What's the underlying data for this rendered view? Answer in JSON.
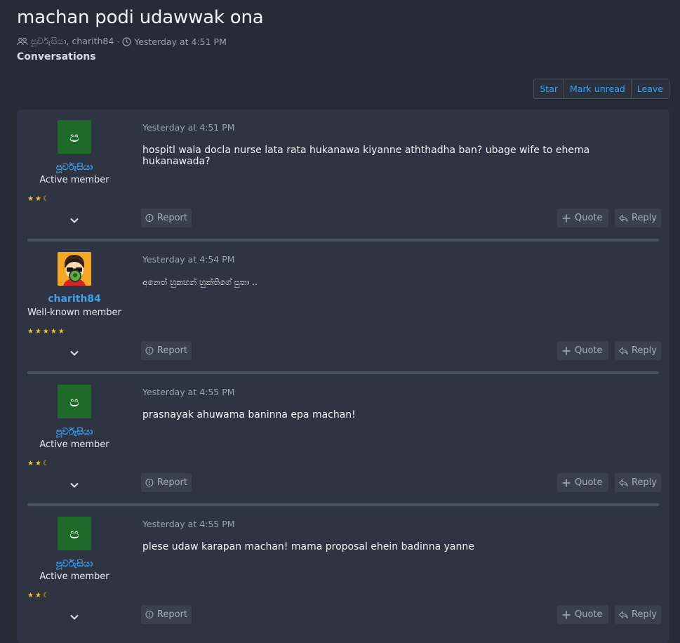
{
  "thread": {
    "title": "machan podi udawwak ona",
    "participants": "පූර්වැසියා, charith84",
    "separator": "·",
    "date": "Yesterday at 4:51 PM",
    "breadcrumb": "Conversations"
  },
  "toolbar": {
    "star": "Star",
    "mark_unread": "Mark unread",
    "leave": "Leave"
  },
  "messages": [
    {
      "avatar_letter": "ප",
      "username": "පූර්වැසියා",
      "user_title": "Active member",
      "stars": "★★",
      "date": "Yesterday at 4:51 PM",
      "body": "hospitl wala docla nurse lata rata hukanawa kiyanne aththadha ban? ubage wife to ehema hukanawada?",
      "report": "Report",
      "quote": "Quote",
      "reply": "Reply"
    },
    {
      "avatar_letter": "",
      "username": "charith84",
      "user_title": "Well-known member",
      "stars": "★★★★★",
      "date": "Yesterday at 4:54 PM",
      "body": "අනෙත් හුකහන් හුක්තිගේ පුතා ..",
      "report": "Report",
      "quote": "Quote",
      "reply": "Reply"
    },
    {
      "avatar_letter": "ප",
      "username": "පූර්වැසියා",
      "user_title": "Active member",
      "stars": "★★",
      "date": "Yesterday at 4:55 PM",
      "body": "prasnayak ahuwama baninna epa machan!",
      "report": "Report",
      "quote": "Quote",
      "reply": "Reply"
    },
    {
      "avatar_letter": "ප",
      "username": "පූර්වැසියා",
      "user_title": "Active member",
      "stars": "★★",
      "date": "Yesterday at 4:55 PM",
      "body": "plese udaw karapan machan! mama proposal ehein badinna yanne",
      "report": "Report",
      "quote": "Quote",
      "reply": "Reply"
    }
  ],
  "colors": {
    "page_bg": "#262b36",
    "panel_bg": "#2e3441",
    "link": "#3d9ff0",
    "avatar_green": "#1e6a28",
    "star": "#f5c518",
    "online": "#5bb237"
  }
}
